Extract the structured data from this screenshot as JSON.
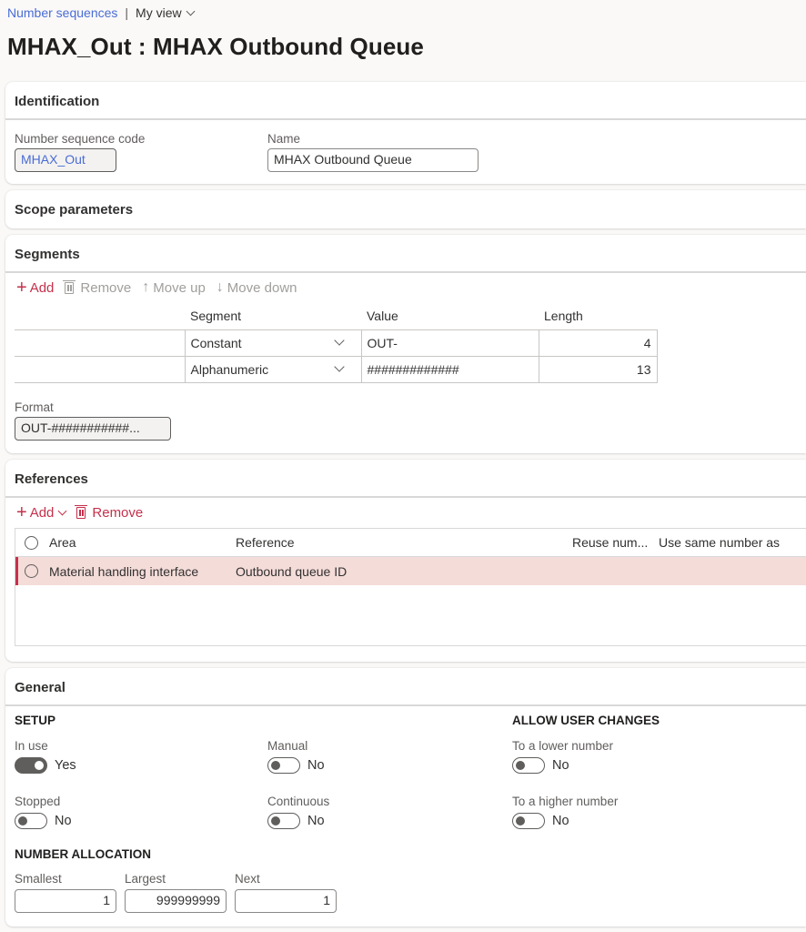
{
  "breadcrumb": {
    "link": "Number sequences",
    "separator": "|",
    "view": "My view"
  },
  "title": "MHAX_Out : MHAX Outbound Queue",
  "identification": {
    "header": "Identification",
    "code_label": "Number sequence code",
    "code_value": "MHAX_Out",
    "name_label": "Name",
    "name_value": "MHAX Outbound Queue"
  },
  "scope": {
    "header": "Scope parameters"
  },
  "segments": {
    "header": "Segments",
    "toolbar": {
      "add": "Add",
      "remove": "Remove",
      "move_up": "Move up",
      "move_down": "Move down"
    },
    "columns": [
      "Segment",
      "Value",
      "Length"
    ],
    "rows": [
      {
        "segment": "Constant",
        "value": "OUT-",
        "length": "4"
      },
      {
        "segment": "Alphanumeric",
        "value": "#############",
        "length": "13"
      }
    ],
    "format_label": "Format",
    "format_value": "OUT-###########..."
  },
  "references": {
    "header": "References",
    "toolbar": {
      "add": "Add",
      "remove": "Remove"
    },
    "columns": {
      "area": "Area",
      "reference": "Reference",
      "reuse": "Reuse num...",
      "same": "Use same number as"
    },
    "rows": [
      {
        "area": "Material handling interface",
        "reference": "Outbound queue ID",
        "reuse": "",
        "same": ""
      }
    ]
  },
  "general": {
    "header": "General",
    "setup_title": "SETUP",
    "allow_title": "ALLOW USER CHANGES",
    "alloc_title": "NUMBER ALLOCATION",
    "in_use": {
      "label": "In use",
      "value": "Yes",
      "on": true
    },
    "manual": {
      "label": "Manual",
      "value": "No",
      "on": false
    },
    "stopped": {
      "label": "Stopped",
      "value": "No",
      "on": false
    },
    "continuous": {
      "label": "Continuous",
      "value": "No",
      "on": false
    },
    "lower": {
      "label": "To a lower number",
      "value": "No",
      "on": false
    },
    "higher": {
      "label": "To a higher number",
      "value": "No",
      "on": false
    },
    "smallest": {
      "label": "Smallest",
      "value": "1"
    },
    "largest": {
      "label": "Largest",
      "value": "999999999"
    },
    "next": {
      "label": "Next",
      "value": "1"
    }
  },
  "colors": {
    "accent": "#c4314b",
    "link": "#4a6cd4",
    "selected_row": "#f4dcd9"
  }
}
